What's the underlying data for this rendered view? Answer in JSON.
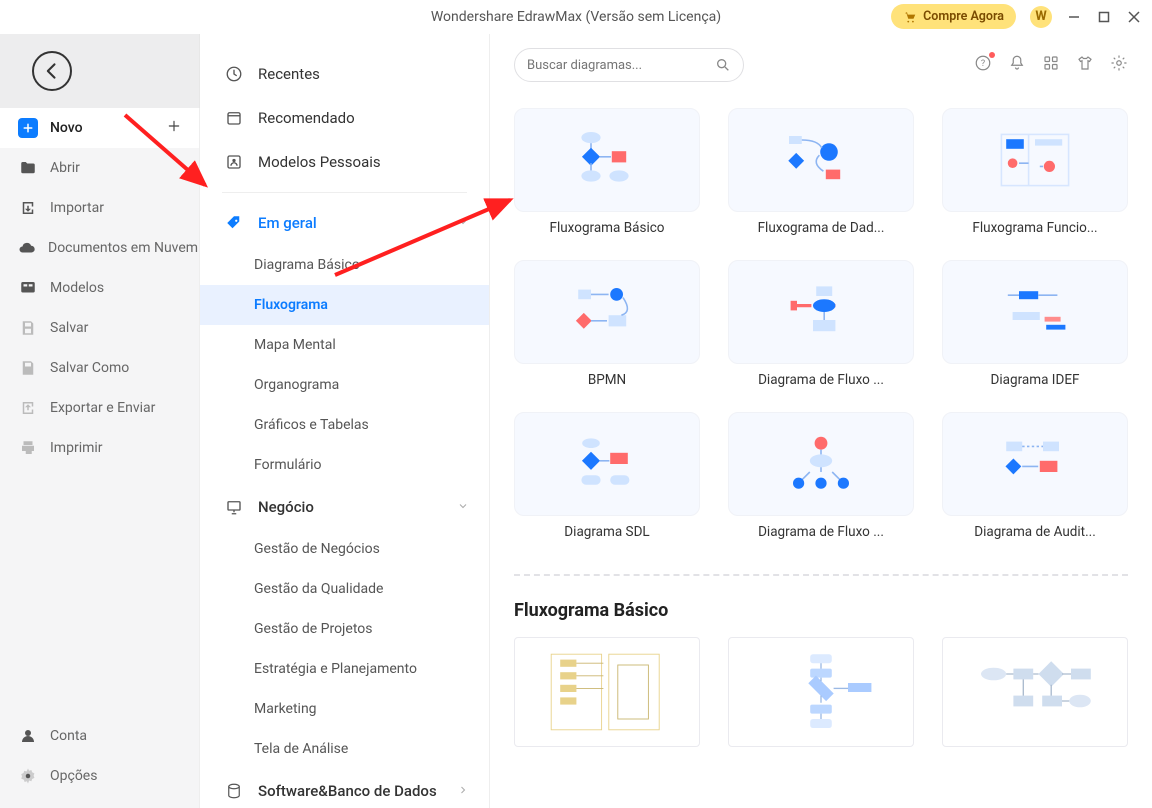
{
  "titlebar": {
    "title": "Wondershare EdrawMax (Versão sem Licença)",
    "buy_label": "Compre Agora",
    "badge_letter": "W"
  },
  "sidebar": {
    "items": [
      {
        "label": "Novo"
      },
      {
        "label": "Abrir"
      },
      {
        "label": "Importar"
      },
      {
        "label": "Documentos em Nuvem"
      },
      {
        "label": "Modelos"
      },
      {
        "label": "Salvar"
      },
      {
        "label": "Salvar Como"
      },
      {
        "label": "Exportar e Enviar"
      },
      {
        "label": "Imprimir"
      }
    ],
    "bottom": [
      {
        "label": "Conta"
      },
      {
        "label": "Opções"
      }
    ]
  },
  "categories": {
    "top": [
      {
        "label": "Recentes"
      },
      {
        "label": "Recomendado"
      },
      {
        "label": "Modelos Pessoais"
      }
    ],
    "groups": [
      {
        "label": "Em geral",
        "items": [
          "Diagrama Básico",
          "Fluxograma",
          "Mapa Mental",
          "Organograma",
          "Gráficos e Tabelas",
          "Formulário"
        ]
      },
      {
        "label": "Negócio",
        "items": [
          "Gestão de Negócios",
          "Gestão da Qualidade",
          "Gestão de Projetos",
          "Estratégia e Planejamento",
          "Marketing",
          "Tela de Análise"
        ]
      },
      {
        "label": "Software&Banco de Dados",
        "items": []
      }
    ]
  },
  "content": {
    "search_placeholder": "Buscar diagramas...",
    "templates": [
      "Fluxograma Básico",
      "Fluxograma de Dad...",
      "Fluxograma Funcio...",
      "BPMN",
      "Diagrama de Fluxo ...",
      "Diagrama IDEF",
      "Diagrama SDL",
      "Diagrama de Fluxo ...",
      "Diagrama de Audit..."
    ],
    "section_title": "Fluxograma Básico"
  }
}
